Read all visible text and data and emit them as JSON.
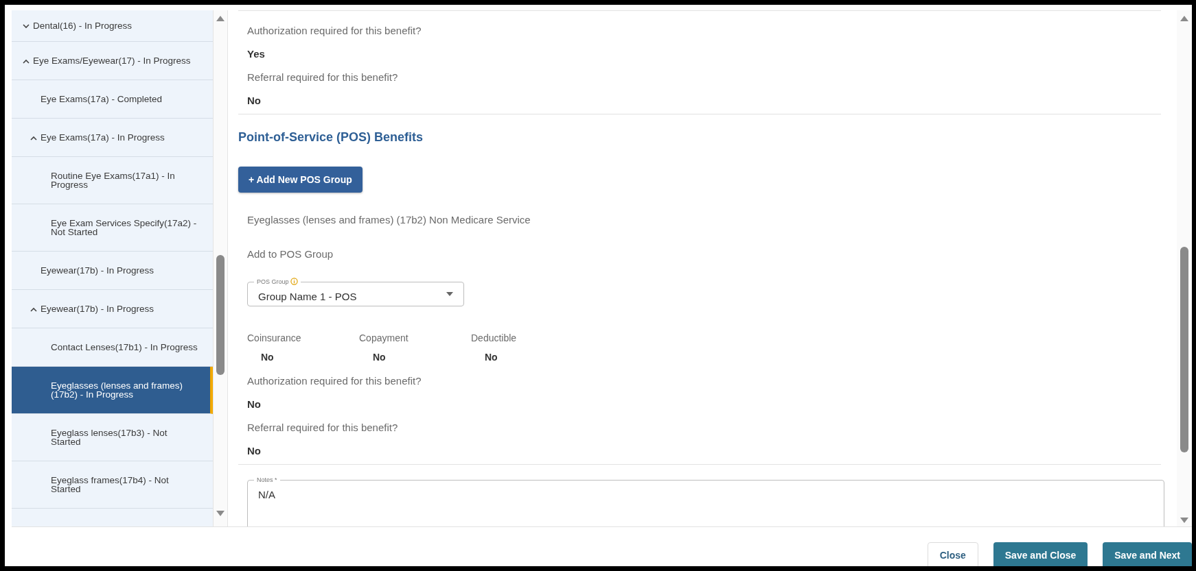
{
  "sidebar": {
    "items": [
      {
        "label": "Dental(16) - In Progress",
        "expanded": false,
        "selected": false
      },
      {
        "label": "Eye Exams/Eyewear(17) - In Progress",
        "expanded": true,
        "selected": false,
        "children": [
          {
            "label": "Eye Exams(17a) - Completed",
            "selected": false
          },
          {
            "label": "Eye Exams(17a) - In Progress",
            "expanded": true,
            "selected": false,
            "children": [
              {
                "label": "Routine Eye Exams(17a1) - In Progress",
                "selected": false
              },
              {
                "label": "Eye Exam Services Specify(17a2) - Not Started",
                "selected": false
              }
            ]
          },
          {
            "label": "Eyewear(17b) - In Progress",
            "selected": false
          },
          {
            "label": "Eyewear(17b) - In Progress",
            "expanded": true,
            "selected": false,
            "children": [
              {
                "label": "Contact Lenses(17b1) - In Progress",
                "selected": false
              },
              {
                "label": "Eyeglasses (lenses and frames) (17b2) - In Progress",
                "selected": true
              },
              {
                "label": "Eyeglass lenses(17b3) - Not Started",
                "selected": false
              },
              {
                "label": "Eyeglass frames(17b4) - Not Started",
                "selected": false
              }
            ]
          }
        ]
      }
    ]
  },
  "content": {
    "top_questions": [
      {
        "question": "Authorization required for this benefit?",
        "answer": "Yes"
      },
      {
        "question": "Referral required for this benefit?",
        "answer": "No"
      }
    ],
    "section_title": "Point-of-Service (POS) Benefits",
    "add_button": "+ Add New POS Group",
    "service_name": "Eyeglasses (lenses and frames) (17b2) Non Medicare Service",
    "add_to_group_label": "Add to POS Group",
    "pos_group": {
      "label": "POS Group",
      "value": "Group Name 1 - POS"
    },
    "cost_sharing": [
      {
        "label": "Coinsurance",
        "value": "No"
      },
      {
        "label": "Copayment",
        "value": "No"
      },
      {
        "label": "Deductible",
        "value": "No"
      }
    ],
    "questions": [
      {
        "question": "Authorization required for this benefit?",
        "answer": "No"
      },
      {
        "question": "Referral required for this benefit?",
        "answer": "No"
      }
    ],
    "notes": {
      "label": "Notes *",
      "value": "N/A"
    }
  },
  "footer": {
    "buttons": [
      {
        "label": "Close",
        "kind": "secondary"
      },
      {
        "label": "Save and Close",
        "kind": "primary"
      },
      {
        "label": "Save and Next",
        "kind": "primary"
      }
    ]
  }
}
